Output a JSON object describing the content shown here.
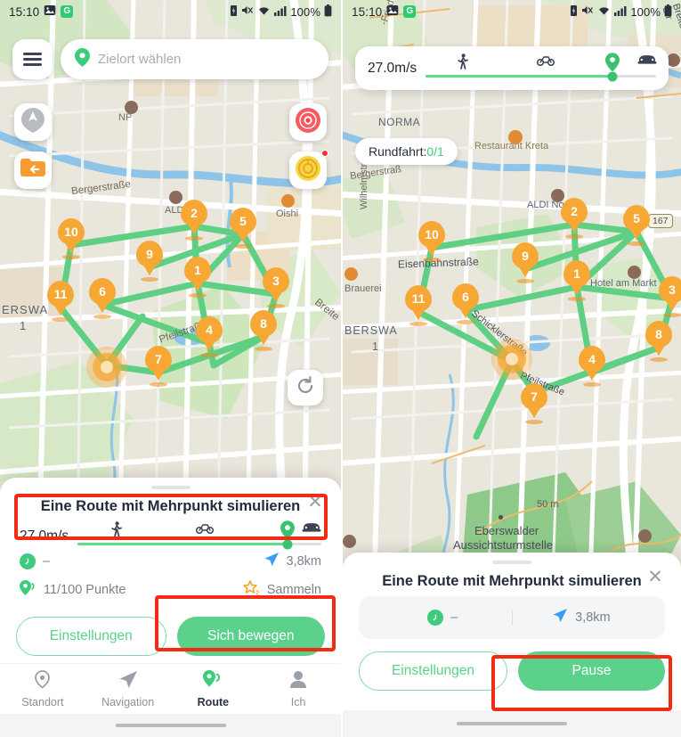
{
  "app": {
    "status_bar": {
      "time": "15:10",
      "battery_percent": "100%",
      "icons": [
        "image-icon",
        "app-badge-g",
        "battery-saver-icon",
        "mute-icon",
        "wifi-icon",
        "signal-icon",
        "battery-icon"
      ]
    }
  },
  "left_screen": {
    "search": {
      "placeholder": "Zielort wählen",
      "menu_icon": "hamburger-icon",
      "pin_icon": "location-pin-icon"
    },
    "map_buttons": [
      {
        "name": "compass-button",
        "icon": "compass-icon"
      },
      {
        "name": "import-route-button",
        "icon": "folder-arrow-icon"
      },
      {
        "name": "record-button",
        "icon": "record-target-icon"
      },
      {
        "name": "coins-button",
        "icon": "coin-icon",
        "badge": true
      },
      {
        "name": "refresh-button",
        "icon": "refresh-icon"
      }
    ],
    "markers": [
      "1",
      "2",
      "3",
      "4",
      "5",
      "6",
      "7",
      "8",
      "9",
      "10",
      "11"
    ],
    "map_labels": [
      "NP",
      "Bergerstraße",
      "ALDI N",
      "Oishi",
      "ERSWA",
      "1",
      "Pfeilstraß",
      "Breite"
    ],
    "sheet": {
      "title": "Eine Route mit Mehrpunkt simulieren",
      "close_icon": "close-icon",
      "speed": {
        "value": "27.0m/s",
        "modes": [
          "walk-icon",
          "bike-icon",
          "car-icon"
        ],
        "fill_percent": 86
      },
      "stats": [
        {
          "icon": "clock-icon",
          "label": "–"
        },
        {
          "icon": "navigate-icon",
          "label": "3,8km"
        },
        {
          "icon": "points-icon",
          "label": "11/100 Punkte"
        },
        {
          "icon": "star-icon",
          "label": "Sammeln"
        }
      ],
      "buttons": {
        "settings": "Einstellungen",
        "primary": "Sich bewegen"
      }
    },
    "navbar": [
      {
        "label": "Standort",
        "icon": "location-pin-icon",
        "active": false
      },
      {
        "label": "Navigation",
        "icon": "paper-plane-icon",
        "active": false
      },
      {
        "label": "Route",
        "icon": "route-points-icon",
        "active": true
      },
      {
        "label": "Ich",
        "icon": "person-icon",
        "active": false
      }
    ]
  },
  "right_screen": {
    "speed_card": {
      "value": "27.0m/s",
      "modes": [
        "walk-icon",
        "bike-icon",
        "car-icon"
      ],
      "fill_percent": 81
    },
    "round_trip_chip": {
      "label": "Rundfahrt:",
      "value": "0/1"
    },
    "markers": [
      "1",
      "2",
      "3",
      "4",
      "5",
      "6",
      "7",
      "8",
      "9",
      "10",
      "11"
    ],
    "map_labels": [
      "-Fried",
      "NORMA",
      "Restaurant Kreta",
      "Bergerstraß",
      "Wilhelmstraße",
      "Eisenbahnstraße",
      "Brauerei",
      "ALDI Nord",
      "Hotel am Markt",
      "BERSWA",
      "1",
      "Schicklerstraße",
      "Pfeilstraße",
      "Breite Str",
      "167",
      "50 m",
      "Eberswalder",
      "Aussichtsturmstelle"
    ],
    "sheet": {
      "title": "Eine Route mit Mehrpunkt simulieren",
      "close_icon": "close-icon",
      "stats": [
        {
          "icon": "clock-icon",
          "label": "–"
        },
        {
          "icon": "navigate-icon",
          "label": "3,8km"
        }
      ],
      "buttons": {
        "settings": "Einstellungen",
        "primary": "Pause"
      }
    }
  },
  "colors": {
    "accent_green": "#5bd18c",
    "marker_orange": "#f7a733",
    "highlight_red": "#f22b12",
    "route_green": "#5fcf84",
    "text_dark": "#242b3d",
    "text_muted": "#7c828c"
  }
}
